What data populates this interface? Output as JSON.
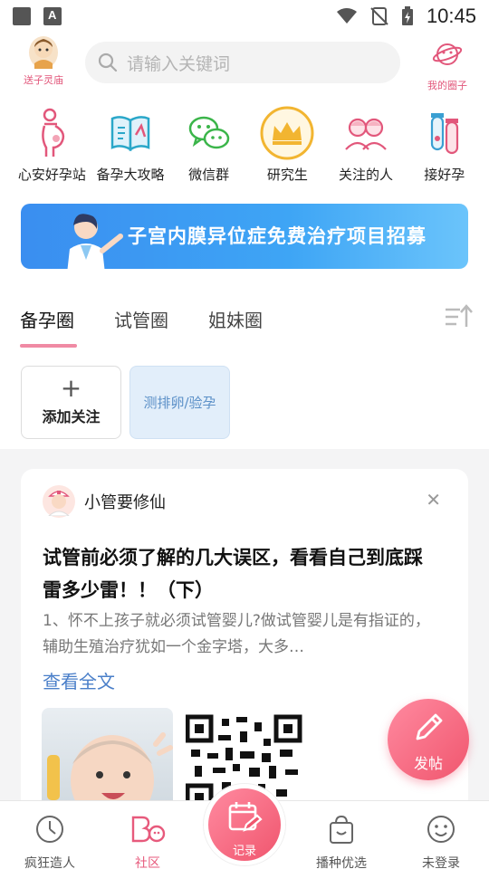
{
  "status_bar": {
    "time": "10:45"
  },
  "header": {
    "left_label": "送子灵庙",
    "search_placeholder": "请输入关键词",
    "right_label": "我的圈子"
  },
  "quick_icons": [
    {
      "label": "心安好孕站",
      "icon": "pregnant-woman-icon"
    },
    {
      "label": "备孕大攻略",
      "icon": "book-icon"
    },
    {
      "label": "微信群",
      "icon": "wechat-icon"
    },
    {
      "label": "研究生",
      "icon": "crown-icon"
    },
    {
      "label": "关注的人",
      "icon": "people-icon"
    },
    {
      "label": "接好孕",
      "icon": "vial-icon"
    }
  ],
  "banner": {
    "text": "子宫内膜异位症免费治疗项目招募"
  },
  "tabs": [
    "备孕圈",
    "试管圈",
    "姐妹圈"
  ],
  "chips": {
    "add_label": "添加关注",
    "topic_label": "测排卵/验孕"
  },
  "post": {
    "author": "小管要修仙",
    "title": "试管前必须了解的几大误区，看看自己到底踩雷多少雷！！（下）",
    "excerpt": "1、怀不上孩子就必须试管婴儿?做试管婴儿是有指证的，辅助生殖治疗犹如一个金字塔，大多…",
    "read_more": "查看全文"
  },
  "fab_label": "发帖",
  "bottom_nav": [
    {
      "label": "疯狂造人"
    },
    {
      "label": "社区"
    },
    {
      "label": "记录"
    },
    {
      "label": "播种优选"
    },
    {
      "label": "未登录"
    }
  ],
  "colors": {
    "accent_pink": "#e75a7c",
    "link_blue": "#4a7fc9",
    "banner_blue": "#3a8ef0"
  }
}
